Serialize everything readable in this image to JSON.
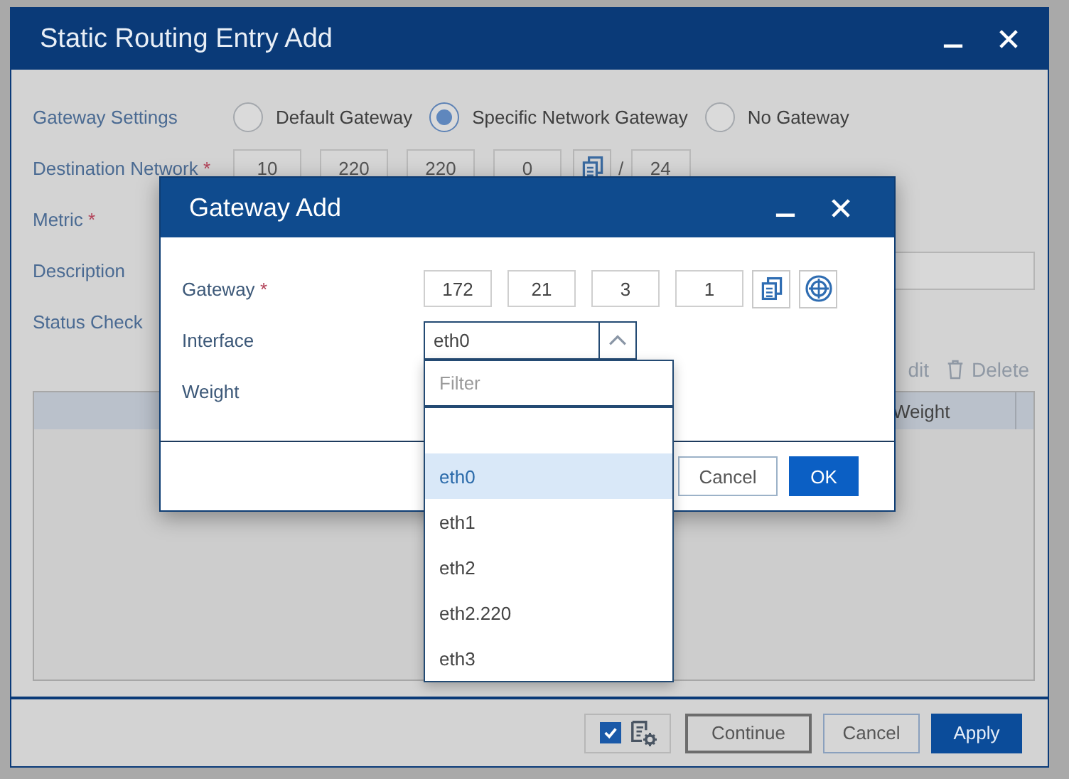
{
  "main_dialog": {
    "title": "Static Routing Entry Add",
    "gateway_settings": {
      "label": "Gateway Settings",
      "options": [
        {
          "label": "Default Gateway",
          "selected": false
        },
        {
          "label": "Specific Network Gateway",
          "selected": true
        },
        {
          "label": "No Gateway",
          "selected": false
        }
      ]
    },
    "destination_network": {
      "label": "Destination Network",
      "required_mark": "*",
      "octets": [
        "10",
        "220",
        "220",
        "0"
      ],
      "separator": "/",
      "prefix": "24"
    },
    "metric": {
      "label": "Metric",
      "required_mark": "*"
    },
    "description": {
      "label": "Description"
    },
    "status_check": {
      "label": "Status Check"
    },
    "toolbar": [
      "dit",
      "Delete"
    ],
    "table": {
      "columns": [
        "Weight"
      ]
    },
    "footer": {
      "checkbox_checked": true,
      "buttons": [
        {
          "label": "Continue",
          "kind": "outline"
        },
        {
          "label": "Cancel",
          "kind": "secondary"
        },
        {
          "label": "Apply",
          "kind": "primary"
        }
      ]
    }
  },
  "gateway_dialog": {
    "title": "Gateway Add",
    "gateway": {
      "label": "Gateway",
      "required_mark": "*",
      "octets": [
        "172",
        "21",
        "3",
        "1"
      ]
    },
    "interface": {
      "label": "Interface",
      "value": "eth0",
      "expanded": true,
      "filter_placeholder": "Filter",
      "options": [
        {
          "label": "eth0",
          "selected": true
        },
        {
          "label": "eth1",
          "selected": false
        },
        {
          "label": "eth2",
          "selected": false
        },
        {
          "label": "eth2.220",
          "selected": false
        },
        {
          "label": "eth3",
          "selected": false
        }
      ]
    },
    "weight": {
      "label": "Weight"
    },
    "buttons": [
      {
        "label": "Cancel",
        "kind": "secondary"
      },
      {
        "label": "OK",
        "kind": "primary"
      }
    ]
  }
}
